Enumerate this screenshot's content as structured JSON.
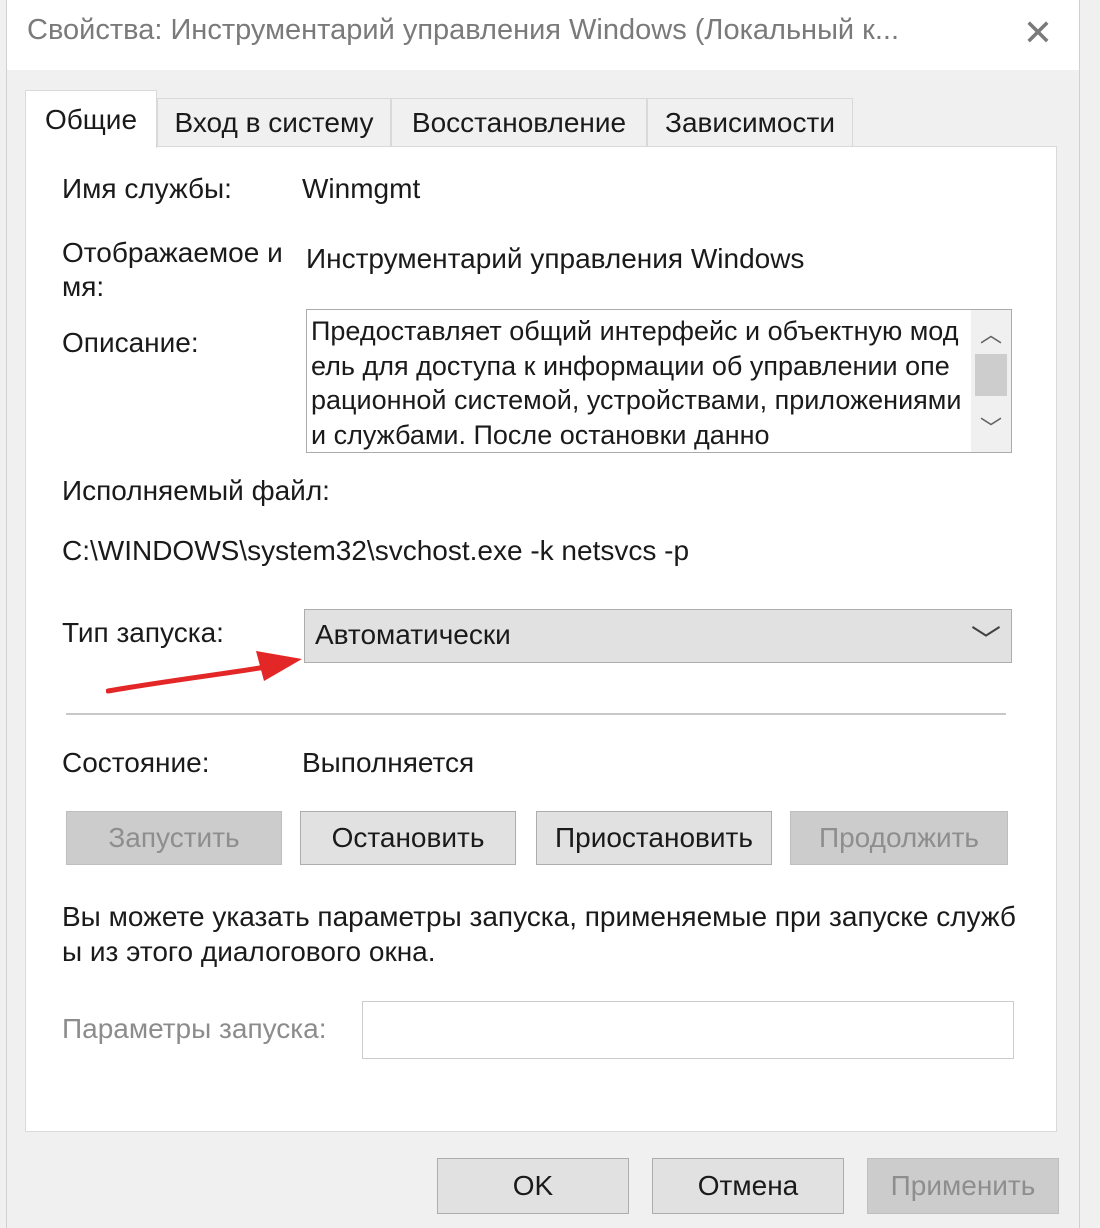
{
  "window": {
    "title": "Свойства: Инструментарий управления Windows (Локальный к..."
  },
  "tabs": [
    {
      "label": "Общие",
      "active": true
    },
    {
      "label": "Вход в систему",
      "active": false
    },
    {
      "label": "Восстановление",
      "active": false
    },
    {
      "label": "Зависимости",
      "active": false
    }
  ],
  "general": {
    "service_name_label": "Имя службы:",
    "service_name_value": "Winmgmt",
    "display_name_label_line1": "Отображаемое и",
    "display_name_label_line2": "мя:",
    "display_name_value": "Инструментарий управления Windows",
    "description_label": "Описание:",
    "description_value": "Предоставляет общий интерфейс и объектную модель для доступа к информации об управлении операционной системой, устройствами, приложениями и службами. После остановки данно",
    "exe_label": "Исполняемый файл:",
    "exe_value": "C:\\WINDOWS\\system32\\svchost.exe -k netsvcs -p",
    "startup_type_label": "Тип запуска:",
    "startup_type_value": "Автоматически",
    "status_label": "Состояние:",
    "status_value": "Выполняется",
    "buttons": {
      "start": "Запустить",
      "stop": "Остановить",
      "pause": "Приостановить",
      "resume": "Продолжить"
    },
    "hint": "Вы можете указать параметры запуска, применяемые при запуске службы из этого диалогового окна.",
    "params_label": "Параметры запуска:",
    "params_value": ""
  },
  "footer": {
    "ok": "OK",
    "cancel": "Отмена",
    "apply": "Применить"
  },
  "colors": {
    "annotation_arrow": "#e32626"
  }
}
